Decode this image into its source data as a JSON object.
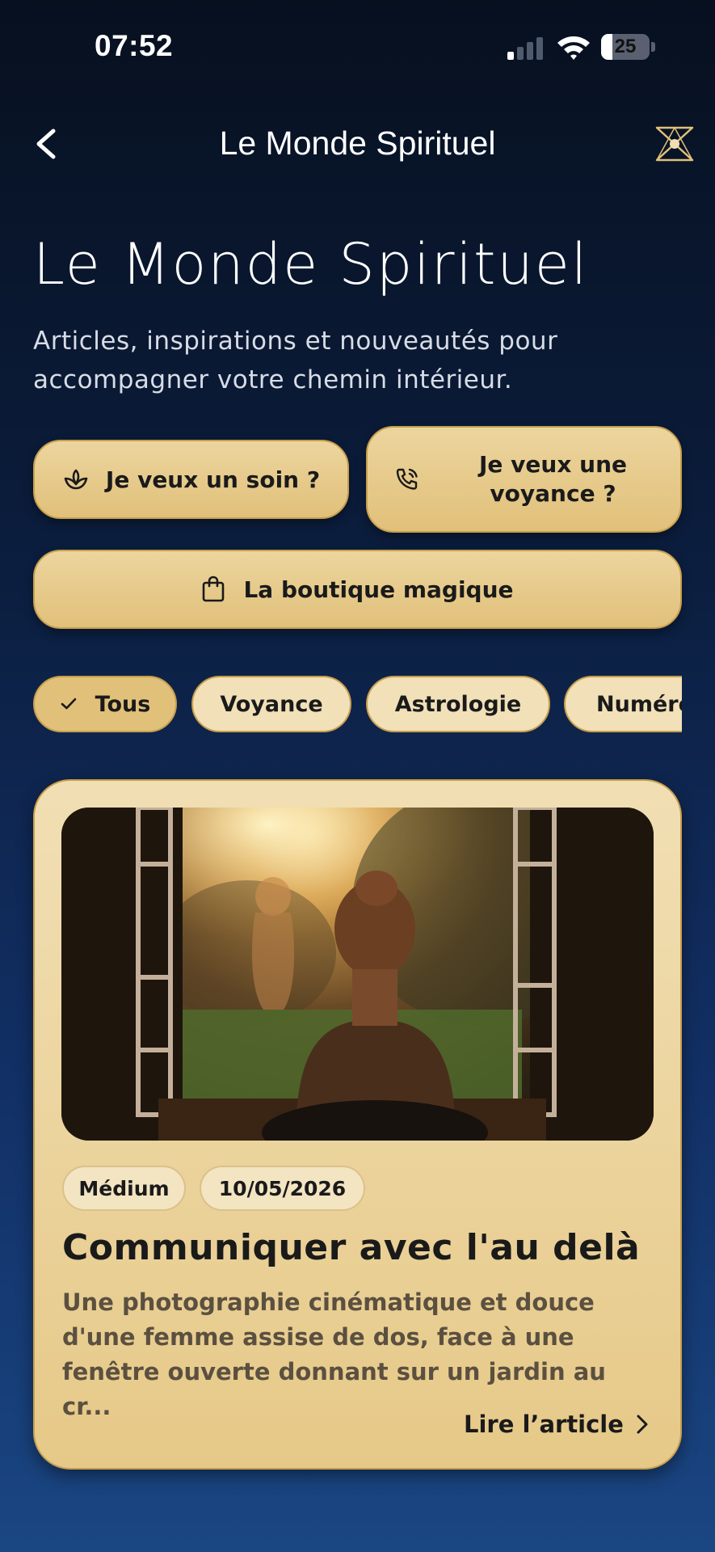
{
  "status_bar": {
    "time": "07:52",
    "battery": "25"
  },
  "nav": {
    "title": "Le Monde Spirituel"
  },
  "header": {
    "title": "Le Monde Spirituel",
    "subtitle": "Articles, inspirations et nouveautés pour accompagner votre chemin intérieur."
  },
  "actions": {
    "soin": "Je veux un soin ?",
    "voyance": "Je veux une voyance ?",
    "boutique": "La boutique magique"
  },
  "filters": [
    {
      "label": "Tous",
      "active": true
    },
    {
      "label": "Voyance",
      "active": false
    },
    {
      "label": "Astrologie",
      "active": false
    },
    {
      "label": "Numérologie",
      "active": false
    }
  ],
  "article": {
    "category": "Médium",
    "date": "10/05/2026",
    "title": "Communiquer avec l'au delà",
    "excerpt": "Une photographie cinématique et douce d'une femme assise de dos, face à une fenêtre ouverte donnant sur un jardin au cr...",
    "read_more": "Lire l’article"
  },
  "colors": {
    "accent": "#e1c07a",
    "accent_border": "#c79e4c",
    "background_top": "#07101f",
    "background_bottom": "#1a4682"
  }
}
